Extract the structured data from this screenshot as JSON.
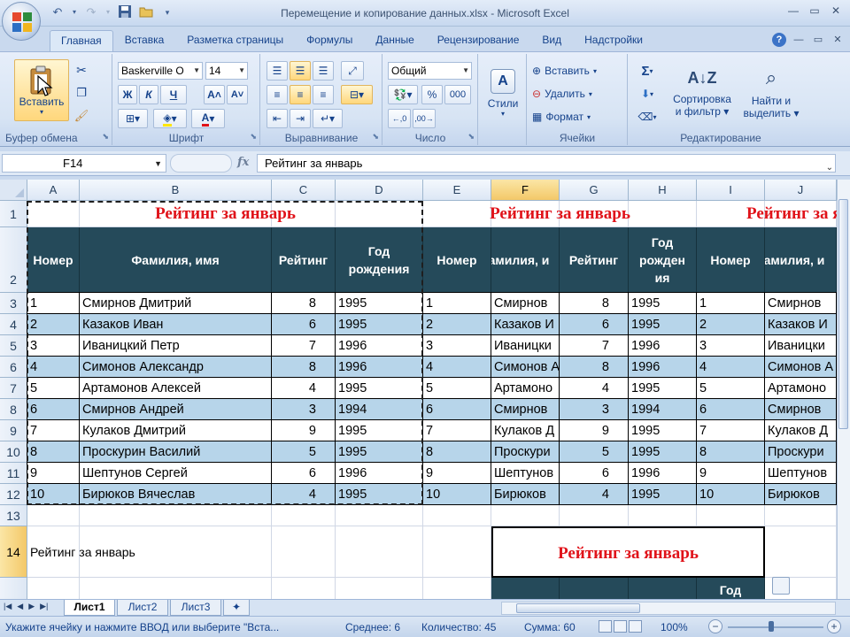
{
  "window": {
    "title": "Перемещение и копирование данных.xlsx - Microsoft Excel",
    "qat_icons": [
      "undo-icon",
      "redo-icon",
      "save-icon",
      "open-folder-icon",
      "customize-qat-icon"
    ]
  },
  "ribbon": {
    "tabs": [
      "Главная",
      "Вставка",
      "Разметка страницы",
      "Формулы",
      "Данные",
      "Рецензирование",
      "Вид",
      "Надстройки"
    ],
    "active_tab": "Главная",
    "clipboard": {
      "paste_label": "Вставить",
      "group_label": "Буфер обмена"
    },
    "font": {
      "name": "Baskerville O",
      "size": "14",
      "bold": "Ж",
      "italic": "К",
      "underline": "Ч",
      "group_label": "Шрифт"
    },
    "alignment": {
      "group_label": "Выравнивание"
    },
    "number": {
      "format": "Общий",
      "percent": "%",
      "thousands": "000",
      "group_label": "Число"
    },
    "styles": {
      "label": "Стили"
    },
    "cells": {
      "insert": "Вставить",
      "delete": "Удалить",
      "format": "Формат",
      "group_label": "Ячейки"
    },
    "editing": {
      "sigma": "Σ",
      "sort_label_1": "Сортировка",
      "sort_label_2": "и фильтр",
      "find_label_1": "Найти и",
      "find_label_2": "выделить",
      "group_label": "Редактирование"
    }
  },
  "formula_bar": {
    "cell_ref": "F14",
    "fx": "fx",
    "content": "Рейтинг за январь"
  },
  "grid": {
    "columns": [
      "A",
      "B",
      "C",
      "D",
      "E",
      "F",
      "G",
      "H",
      "I",
      "J"
    ],
    "rows": [
      "1",
      "2",
      "3",
      "4",
      "5",
      "6",
      "7",
      "8",
      "9",
      "10",
      "11",
      "12",
      "13",
      "14"
    ],
    "table_title": "Рейтинг за январь",
    "headers": {
      "number": "Номер",
      "name": "Фамилия, имя",
      "name_truncated": "амилия, и",
      "rating": "Рейтинг",
      "year_1": "Год",
      "year_2": "рождения",
      "year_2a": "рожден",
      "year_2b": "ия"
    },
    "records": [
      {
        "num": "1",
        "name": "Смирнов Дмитрий",
        "name_short": "Смирнов",
        "rating": "8",
        "year": "1995"
      },
      {
        "num": "2",
        "name": "Казаков Иван",
        "name_short": "Казаков И",
        "rating": "6",
        "year": "1995"
      },
      {
        "num": "3",
        "name": "Иваницкий Петр",
        "name_short": "Иваницки",
        "rating": "7",
        "year": "1996"
      },
      {
        "num": "4",
        "name": "Симонов Александр",
        "name_short": "Симонов А",
        "rating": "8",
        "year": "1996"
      },
      {
        "num": "5",
        "name": "Артамонов Алексей",
        "name_short": "Артамоно",
        "rating": "4",
        "year": "1995"
      },
      {
        "num": "6",
        "name": "Смирнов Андрей",
        "name_short": "Смирнов",
        "rating": "3",
        "year": "1994"
      },
      {
        "num": "7",
        "name": "Кулаков Дмитрий",
        "name_short": "Кулаков Д",
        "rating": "9",
        "year": "1995"
      },
      {
        "num": "8",
        "name": "Проскурин Василий",
        "name_short": "Проскури",
        "rating": "5",
        "year": "1995"
      },
      {
        "num": "9",
        "name": "Шептунов Сергей",
        "name_short": "Шептунов",
        "rating": "6",
        "year": "1996"
      },
      {
        "num": "10",
        "name": "Бирюков Вячеслав",
        "name_short": "Бирюков",
        "rating": "4",
        "year": "1995"
      }
    ],
    "row14_text": "Рейтинг за январь",
    "selected_cell": "F14"
  },
  "sheets": {
    "tabs": [
      "Лист1",
      "Лист2",
      "Лист3"
    ],
    "active": "Лист1"
  },
  "status": {
    "message": "Укажите ячейку и нажмите ВВОД или выберите \"Вста...",
    "average": "Среднее: 6",
    "count": "Количество: 45",
    "sum": "Сумма: 60",
    "zoom": "100%"
  },
  "colors": {
    "title_red": "#e0131a",
    "header_teal": "#254a5a",
    "band_blue": "#b7d5ea",
    "selection_orange": "#f3c868"
  }
}
